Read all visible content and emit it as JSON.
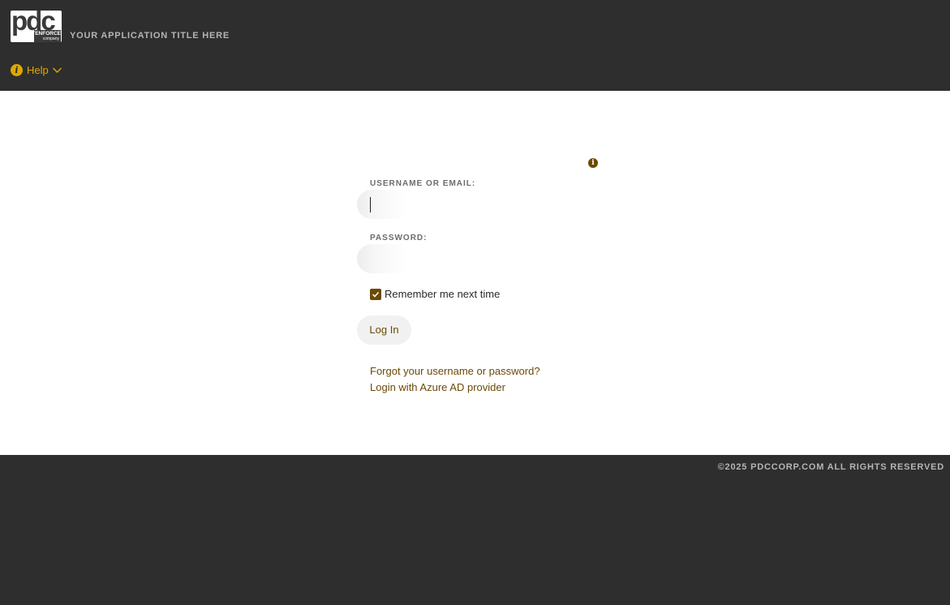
{
  "header": {
    "logo": {
      "mark": "pdc",
      "sub_line1": "TENFORCE",
      "sub_line2": "company"
    },
    "app_title": "YOUR APPLICATION TITLE HERE",
    "help": {
      "icon_glyph": "i",
      "label": "Help"
    }
  },
  "login_form": {
    "info_glyph": "i",
    "username_label": "USERNAME OR EMAIL:",
    "username_value": "",
    "password_label": "PASSWORD:",
    "password_value": "",
    "remember_label": "Remember me next time",
    "remember_checked": true,
    "login_button": "Log In",
    "forgot_link": "Forgot your username or password?",
    "azure_link": "Login with Azure AD provider"
  },
  "footer": {
    "copyright": "©2025 PDCCORP.COM ALL RIGHTS RESERVED"
  },
  "colors": {
    "background": "#2e2e2e",
    "accent_gold": "#e0a800",
    "accent_brown": "#6b4a05",
    "muted_text": "#b5b5b5"
  },
  "icons": [
    "help-info-icon",
    "chevron-down-icon",
    "info-icon",
    "checkmark-icon"
  ]
}
